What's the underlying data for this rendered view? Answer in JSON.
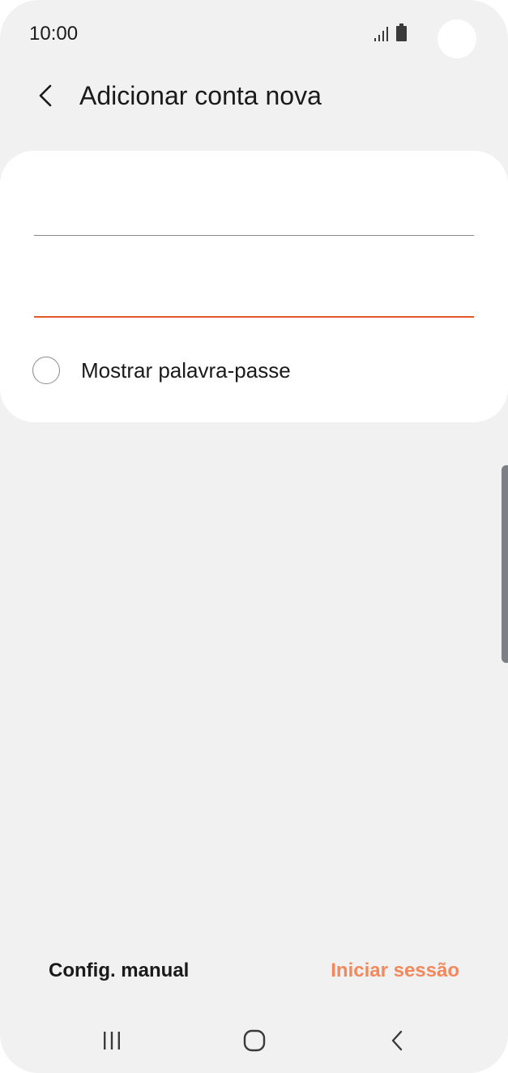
{
  "status_bar": {
    "time": "10:00",
    "icons": [
      "signal-icon",
      "battery-icon"
    ]
  },
  "header": {
    "title": "Adicionar conta nova",
    "back_icon": "chevron-left-icon"
  },
  "form": {
    "email": {
      "value": "",
      "placeholder": ""
    },
    "password": {
      "value": "",
      "placeholder": ""
    },
    "show_password": {
      "label": "Mostrar palavra-passe",
      "checked": false
    }
  },
  "actions": {
    "manual_setup": "Config. manual",
    "sign_in": "Iniciar sessão"
  },
  "nav_bar": {
    "icons": [
      "recents-icon",
      "home-icon",
      "back-icon"
    ]
  },
  "colors": {
    "accent": "#e4582b",
    "sign_in_text": "#f3885c",
    "background": "#f1f1f1",
    "card": "#ffffff"
  }
}
